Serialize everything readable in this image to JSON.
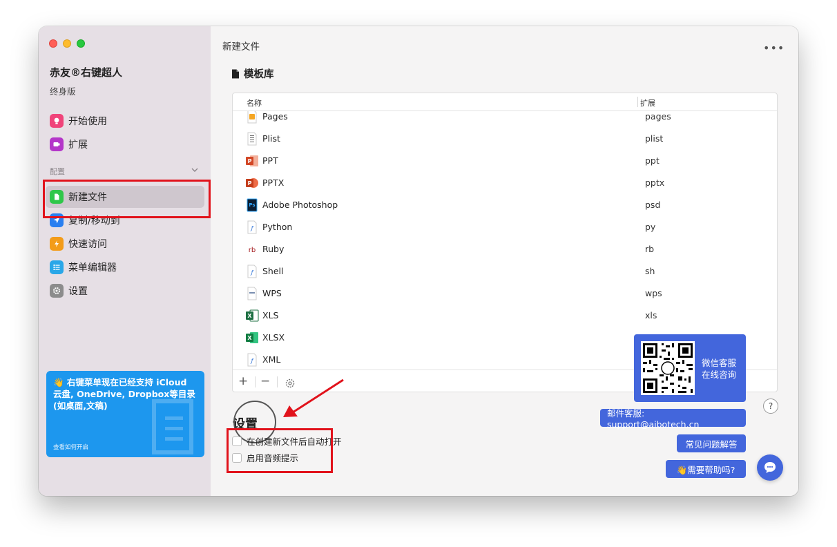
{
  "sidebar": {
    "app_title": "赤友®右键超人",
    "edition": "终身版",
    "top_items": [
      {
        "label": "开始使用",
        "icon": "lightbulb-icon",
        "color": "#f0437a"
      },
      {
        "label": "扩展",
        "icon": "extension-icon",
        "color": "#b436c9"
      }
    ],
    "section_label": "配置",
    "config_items": [
      {
        "label": "新建文件",
        "icon": "new-file-icon",
        "color": "#2fc74a"
      },
      {
        "label": "复制/移动到",
        "icon": "send-icon",
        "color": "#2a7ff0"
      },
      {
        "label": "快速访问",
        "icon": "lightning-icon",
        "color": "#f39c19"
      },
      {
        "label": "菜单编辑器",
        "icon": "list-icon",
        "color": "#2aa7e8"
      },
      {
        "label": "设置",
        "icon": "gear-icon",
        "color": "#8c8c8c"
      }
    ],
    "promo": {
      "text": "👋 右键菜单现在已经支持 iCloud 云盘, OneDrive, Dropbox等目录(如桌面,文稿)",
      "link": "查看如何开启"
    }
  },
  "main": {
    "title": "新建文件",
    "more": "•••",
    "template_heading": "模板库",
    "table": {
      "col_name": "名称",
      "col_ext": "扩展",
      "rows": [
        {
          "name": "Pages",
          "ext": "pages",
          "icon": "pages-file-icon"
        },
        {
          "name": "Plist",
          "ext": "plist",
          "icon": "plist-file-icon"
        },
        {
          "name": "PPT",
          "ext": "ppt",
          "icon": "powerpoint-file-icon"
        },
        {
          "name": "PPTX",
          "ext": "pptx",
          "icon": "powerpoint-file-icon"
        },
        {
          "name": "Adobe Photoshop",
          "ext": "psd",
          "icon": "photoshop-file-icon"
        },
        {
          "name": "Python",
          "ext": "py",
          "icon": "script-file-icon"
        },
        {
          "name": "Ruby",
          "ext": "rb",
          "icon": "ruby-file-icon"
        },
        {
          "name": "Shell",
          "ext": "sh",
          "icon": "script-file-icon"
        },
        {
          "name": "WPS",
          "ext": "wps",
          "icon": "wps-file-icon"
        },
        {
          "name": "XLS",
          "ext": "xls",
          "icon": "excel-file-icon"
        },
        {
          "name": "XLSX",
          "ext": "",
          "icon": "excel-file-icon"
        },
        {
          "name": "XML",
          "ext": "",
          "icon": "script-file-icon"
        }
      ],
      "add_label": "+",
      "remove_label": "−"
    },
    "settings_heading": "设置",
    "options": [
      {
        "label": "在创建新文件后自动打开",
        "checked": false
      },
      {
        "label": "启用音频提示",
        "checked": false
      }
    ]
  },
  "support": {
    "wechat_line1": "微信客服",
    "wechat_line2": "在线咨询",
    "email": "邮件客服: support@aibotech.cn",
    "faq": "常见问题解答",
    "help": "👋需要帮助吗?",
    "question_mark": "?"
  }
}
